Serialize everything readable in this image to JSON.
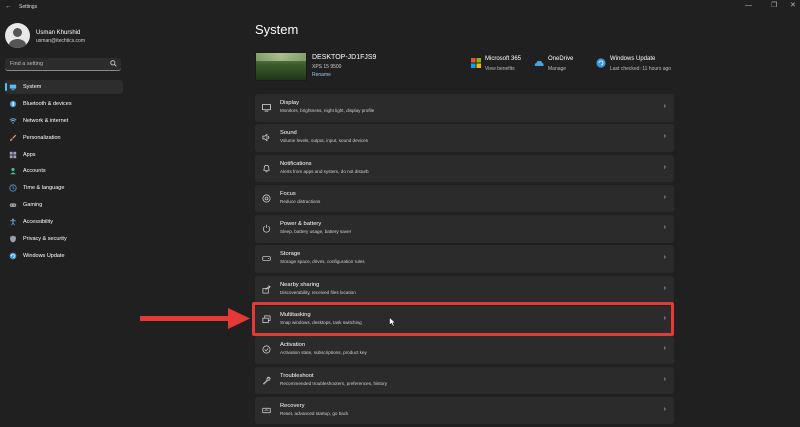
{
  "window": {
    "back_glyph": "←",
    "title": "Settings",
    "controls": [
      "—",
      "❐",
      "✕"
    ]
  },
  "user": {
    "name": "Usman Khurshid",
    "email": "usman@itechtics.com"
  },
  "search": {
    "placeholder": "Find a setting",
    "icon": "search-icon"
  },
  "sidebar": {
    "items": [
      {
        "label": "System",
        "icon": "system-icon",
        "active": true,
        "color": "#4cc2ff"
      },
      {
        "label": "Bluetooth & devices",
        "icon": "bluetooth-icon",
        "color": "#3a96dd"
      },
      {
        "label": "Network & internet",
        "icon": "wifi-icon",
        "color": "#6ab0de"
      },
      {
        "label": "Personalization",
        "icon": "brush-icon",
        "color": "#e8a36b"
      },
      {
        "label": "Apps",
        "icon": "apps-icon",
        "color": "#a0a0c0"
      },
      {
        "label": "Accounts",
        "icon": "accounts-icon",
        "color": "#47c28b"
      },
      {
        "label": "Time & language",
        "icon": "globe-clock-icon",
        "color": "#4aa3df"
      },
      {
        "label": "Gaming",
        "icon": "gamepad-icon",
        "color": "#a0a0a0"
      },
      {
        "label": "Accessibility",
        "icon": "accessibility-icon",
        "color": "#6aa9e9"
      },
      {
        "label": "Privacy & security",
        "icon": "shield-icon",
        "color": "#9aa0a6"
      },
      {
        "label": "Windows Update",
        "icon": "update-icon",
        "color": "#3a96dd"
      }
    ]
  },
  "main": {
    "title": "System",
    "device": {
      "name": "DESKTOP-JD1FJS9",
      "model": "XPS 15 9500",
      "rename": "Rename"
    },
    "top_apps": [
      {
        "name": "Microsoft 365",
        "sub": "View benefits",
        "icon": "microsoft-icon"
      },
      {
        "name": "OneDrive",
        "sub": "Manage",
        "icon": "onedrive-icon"
      },
      {
        "name": "Windows Update",
        "sub": "Last checked: 11 hours ago",
        "icon": "windows-update-icon"
      }
    ],
    "rows": [
      {
        "title": "Display",
        "desc": "Monitors, brightness, night light, display profile",
        "icon": "display-icon"
      },
      {
        "title": "Sound",
        "desc": "Volume levels, output, input, sound devices",
        "icon": "speaker-icon"
      },
      {
        "title": "Notifications",
        "desc": "Alerts from apps and system, do not disturb",
        "icon": "bell-icon"
      },
      {
        "title": "Focus",
        "desc": "Reduce distractions",
        "icon": "focus-icon"
      },
      {
        "title": "Power & battery",
        "desc": "Sleep, battery usage, battery saver",
        "icon": "power-icon"
      },
      {
        "title": "Storage",
        "desc": "Storage space, drives, configuration rules",
        "icon": "storage-icon"
      },
      {
        "title": "Nearby sharing",
        "desc": "Discoverability, received files location",
        "icon": "share-icon"
      },
      {
        "title": "Multitasking",
        "desc": "Snap windows, desktops, task switching",
        "icon": "multitasking-icon",
        "highlighted": true
      },
      {
        "title": "Activation",
        "desc": "Activation state, subscriptions, product key",
        "icon": "activation-icon"
      },
      {
        "title": "Troubleshoot",
        "desc": "Recommended troubleshooters, preferences, history",
        "icon": "wrench-icon"
      },
      {
        "title": "Recovery",
        "desc": "Reset, advanced startup, go back",
        "icon": "recovery-icon"
      }
    ],
    "chevron": "›"
  },
  "colors": {
    "background": "#202020",
    "card": "#2b2b2b",
    "accent": "#4cc2ff",
    "highlight": "#e53935"
  }
}
